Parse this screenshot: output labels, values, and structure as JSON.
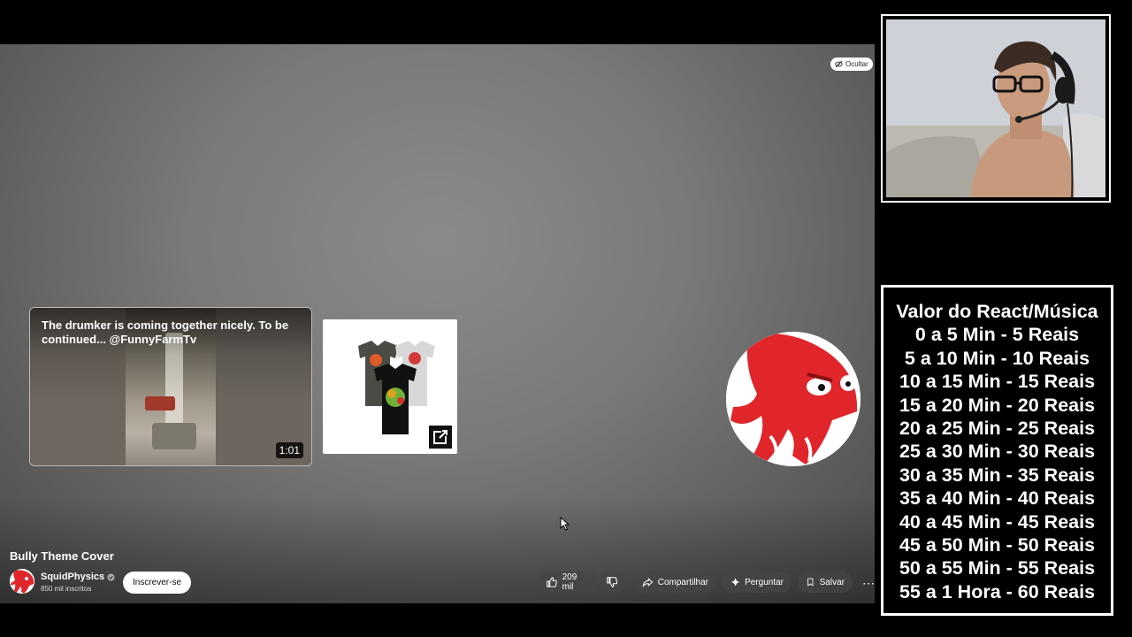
{
  "player": {
    "hide_label": "Ocultar",
    "video_card": {
      "title": "The drumker is coming together nicely. To be continued... @FunnyFarmTv",
      "duration": "1:01"
    },
    "merch_card": {
      "icon": "external-link-icon"
    },
    "channel_bubble": {
      "icon": "squid-logo"
    }
  },
  "video": {
    "title": "Bully Theme Cover",
    "channel_name": "SquidPhysics",
    "subscribers": "850 mil inscritos",
    "subscribe_label": "Inscrever-se",
    "like_count": "209 mil",
    "share_label": "Compartilhar",
    "ask_label": "Perguntar",
    "save_label": "Salvar",
    "more_label": "⋯"
  },
  "price_list": {
    "lines": [
      "Valor do React/Música",
      "0 a 5 Min - 5 Reais",
      "5 a 10 Min - 10 Reais",
      "10 a 15 Min - 15 Reais",
      "15 a 20 Min - 20 Reais",
      "20 a 25 Min - 25 Reais",
      "25 a 30 Min - 30 Reais",
      "30 a 35 Min - 35 Reais",
      "35 a 40 Min - 40 Reais",
      "40 a 45 Min - 45 Reais",
      "45 a 50 Min - 50 Reais",
      "50 a 55 Min - 55 Reais",
      "55 a 1 Hora - 60 Reais"
    ]
  },
  "colors": {
    "background": "#000000",
    "player_gray": "#7a7a7a",
    "brand_red": "#e0262a",
    "panel_border": "#ffffff"
  }
}
